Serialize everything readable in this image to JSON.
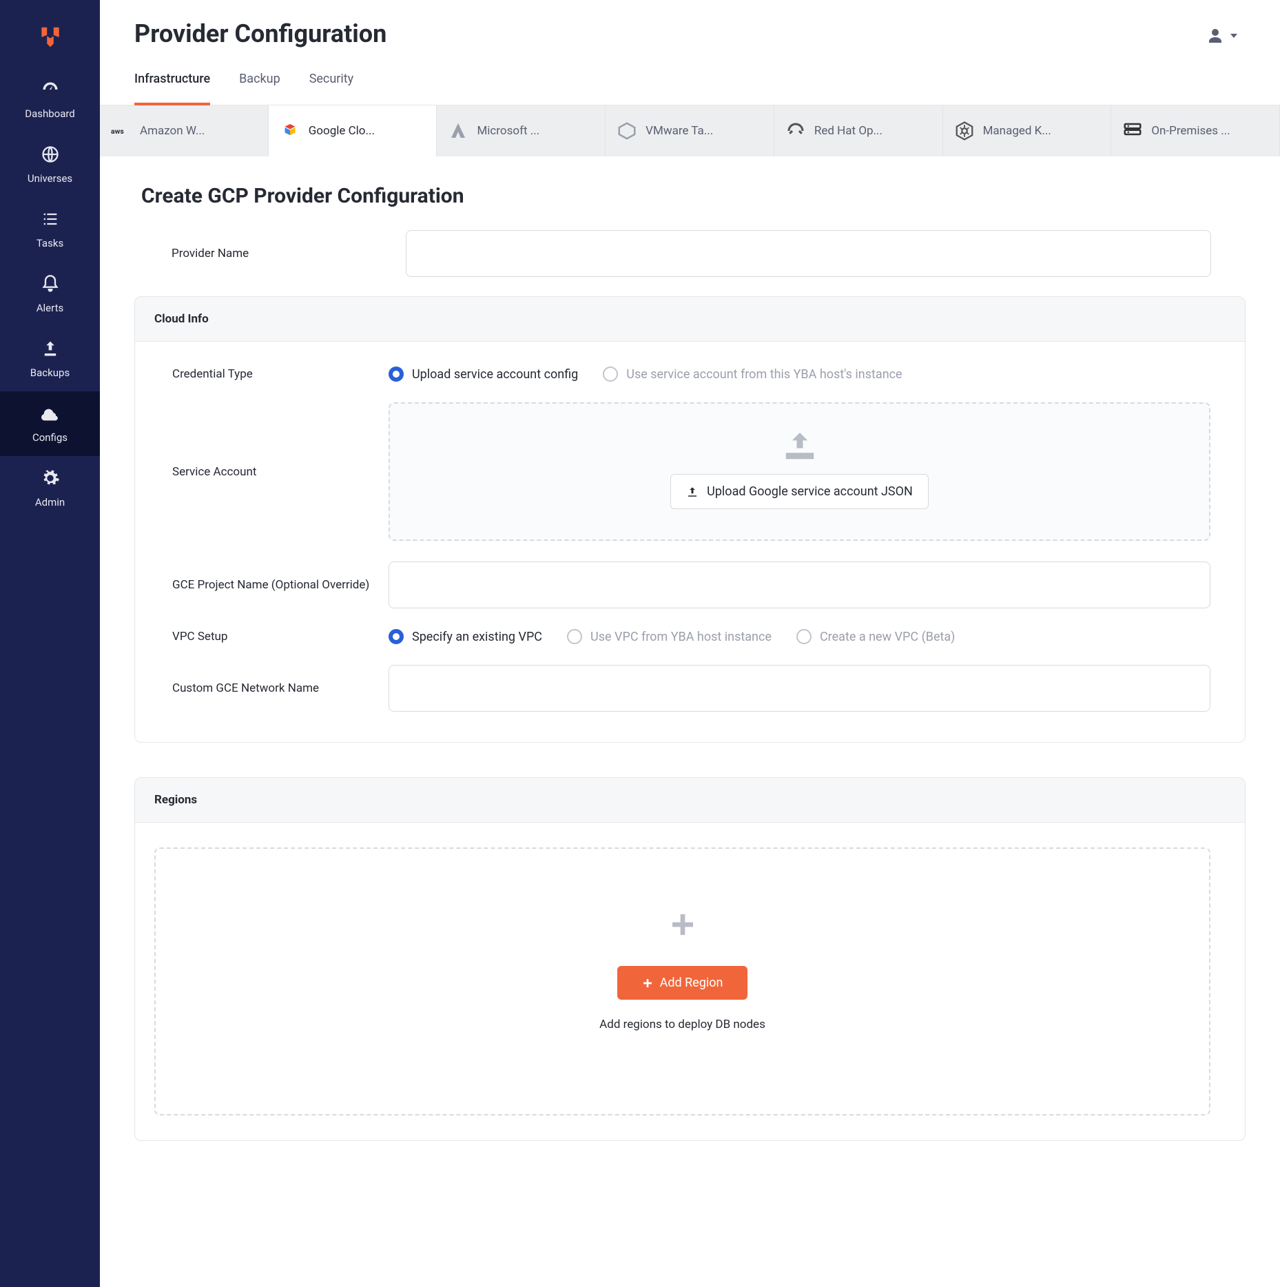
{
  "sidebar": {
    "items": [
      {
        "label": "Dashboard"
      },
      {
        "label": "Universes"
      },
      {
        "label": "Tasks"
      },
      {
        "label": "Alerts"
      },
      {
        "label": "Backups"
      },
      {
        "label": "Configs"
      },
      {
        "label": "Admin"
      }
    ]
  },
  "page": {
    "title": "Provider Configuration"
  },
  "tabs": {
    "items": [
      "Infrastructure",
      "Backup",
      "Security"
    ],
    "active": 0
  },
  "providerTabs": {
    "items": [
      "Amazon W...",
      "Google Clo...",
      "Microsoft ...",
      "VMware Ta...",
      "Red Hat Op...",
      "Managed K...",
      "On-Premises ..."
    ],
    "active": 1
  },
  "form": {
    "title": "Create GCP Provider Configuration",
    "providerNameLabel": "Provider Name",
    "cloudInfoHeader": "Cloud Info",
    "credentialTypeLabel": "Credential Type",
    "credentialTypeOptions": [
      {
        "label": "Upload service account config",
        "checked": true,
        "disabled": false
      },
      {
        "label": "Use service account from this YBA host's instance",
        "checked": false,
        "disabled": true
      }
    ],
    "serviceAccountLabel": "Service Account",
    "uploadButton": "Upload Google service account JSON",
    "gceProjectLabel": "GCE Project Name (Optional Override)",
    "vpcSetupLabel": "VPC Setup",
    "vpcOptions": [
      {
        "label": "Specify an existing VPC",
        "checked": true,
        "disabled": false
      },
      {
        "label": "Use VPC from YBA host instance",
        "checked": false,
        "disabled": true
      },
      {
        "label": "Create a new VPC (Beta)",
        "checked": false,
        "disabled": true
      }
    ],
    "customNetworkLabel": "Custom GCE Network Name",
    "regionsHeader": "Regions",
    "addRegionButton": "Add Region",
    "addRegionHelper": "Add regions to deploy DB nodes"
  }
}
